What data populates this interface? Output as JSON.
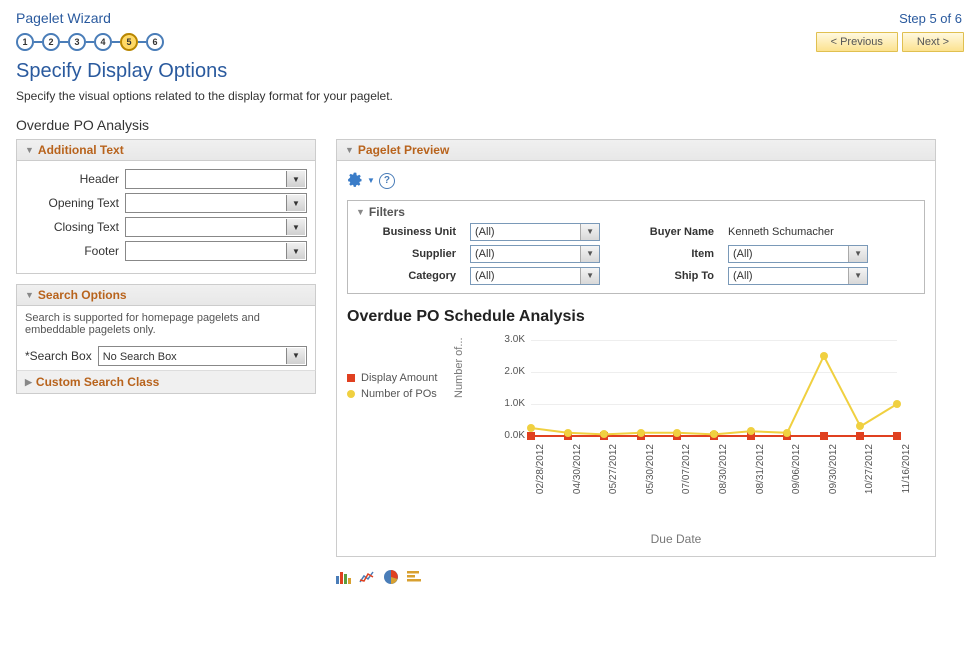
{
  "header": {
    "wizard_title": "Pagelet Wizard",
    "step_label": "Step 5 of 6",
    "prev_button": "< Previous",
    "next_button": "Next >"
  },
  "steps": [
    "1",
    "2",
    "3",
    "4",
    "5",
    "6"
  ],
  "page": {
    "title": "Specify Display Options",
    "description": "Specify the visual options related to the display format for your pagelet.",
    "section_name": "Overdue PO Analysis"
  },
  "additional_text": {
    "panel_title": "Additional Text",
    "fields": {
      "header": "Header",
      "opening": "Opening Text",
      "closing": "Closing Text",
      "footer": "Footer"
    }
  },
  "search_options": {
    "panel_title": "Search Options",
    "description": "Search is supported for homepage pagelets and embeddable pagelets only.",
    "search_box_label": "*Search Box",
    "search_box_value": "No Search Box",
    "custom_search_label": "Custom Search Class"
  },
  "preview": {
    "panel_title": "Pagelet Preview",
    "filters_title": "Filters",
    "filters": {
      "business_unit": {
        "label": "Business Unit",
        "value": "(All)"
      },
      "buyer_name": {
        "label": "Buyer Name",
        "value": "Kenneth Schumacher"
      },
      "supplier": {
        "label": "Supplier",
        "value": "(All)"
      },
      "item": {
        "label": "Item",
        "value": "(All)"
      },
      "category": {
        "label": "Category",
        "value": "(All)"
      },
      "ship_to": {
        "label": "Ship To",
        "value": "(All)"
      }
    }
  },
  "chart_data": {
    "type": "line",
    "title": "Overdue PO Schedule Analysis",
    "xlabel": "Due Date",
    "ylabel": "Number of...",
    "ylim": [
      0,
      3000
    ],
    "yticks": [
      "0.0K",
      "1.0K",
      "2.0K",
      "3.0K"
    ],
    "categories": [
      "02/28/2012",
      "04/30/2012",
      "05/27/2012",
      "05/30/2012",
      "07/07/2012",
      "08/30/2012",
      "08/31/2012",
      "09/06/2012",
      "09/30/2012",
      "10/27/2012",
      "11/16/2012"
    ],
    "series": [
      {
        "name": "Display Amount",
        "color": "#e04020",
        "marker": "square",
        "values": [
          0,
          0,
          0,
          0,
          0,
          0,
          0,
          0,
          0,
          0,
          0
        ]
      },
      {
        "name": "Number of POs",
        "color": "#f0d040",
        "marker": "circle",
        "values": [
          250,
          100,
          50,
          100,
          100,
          50,
          150,
          100,
          2500,
          300,
          1000
        ]
      }
    ]
  }
}
